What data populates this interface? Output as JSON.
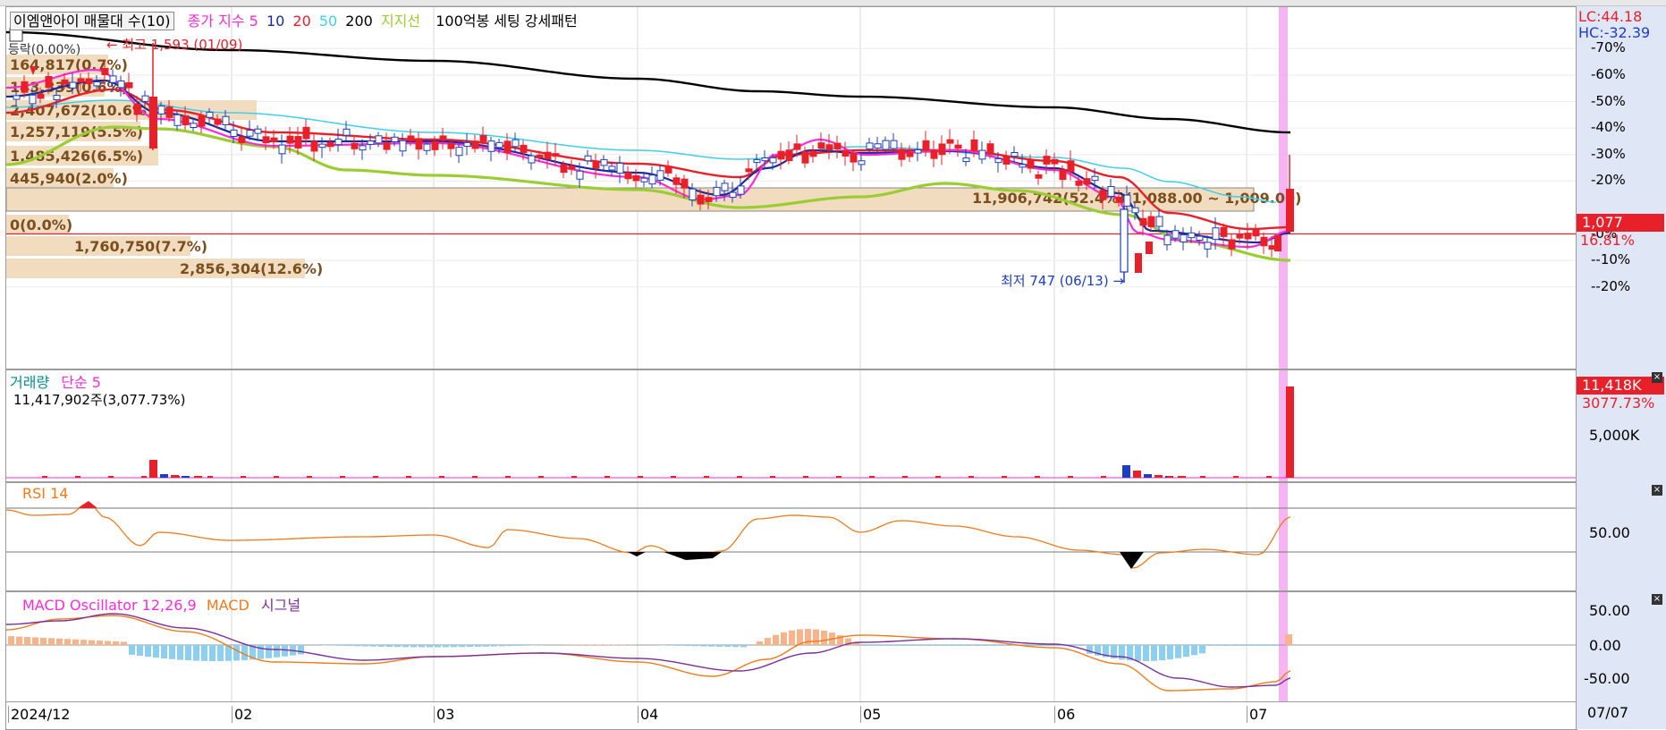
{
  "colors": {
    "up": "#e8202a",
    "down": "#1d3fbf",
    "ma5": "#ff2bd6",
    "ma10": "#1b2a9a",
    "ma20": "#e8202a",
    "ma50": "#3fd0e8",
    "ma200": "#000000",
    "support": "#9acd32",
    "profile": "#f2dcc0",
    "profile_text": "#7a4e1d",
    "axis_bg": "#dfe6f5",
    "highlight": "#f4a7f0",
    "rsi": "#f07a1a",
    "macd": "#f07a1a",
    "signal": "#7b2f9a",
    "osc_pos": "#f7b48a",
    "osc_neg": "#8ccfee"
  },
  "price_panel": {
    "legend": {
      "title": "이엠앤아이 매물대 수(10)",
      "close_ma_label": "종가 지수",
      "ma_periods": [
        "5",
        "10",
        "20",
        "50",
        "200"
      ],
      "support_label": "지지선",
      "pattern_label": "100억봉 세팅 강세패턴"
    },
    "axis_right": {
      "lc": "LC:44.18",
      "hc": "HC:-32.39",
      "pct_ticks": [
        "70%",
        "60%",
        "50%",
        "40%",
        "30%",
        "20%",
        "0%",
        "-10%",
        "-20%"
      ],
      "current_price": "1,077",
      "current_pct": "16.81%"
    },
    "annotations": {
      "high": "최고 1,593 (01/09)",
      "low": "최저 747 (06/13)",
      "truncated_left": "등락(0.00%)"
    },
    "volume_profile": [
      {
        "label": "164,817(0.7%)",
        "vol": 164817
      },
      {
        "label": "143,339(0.6%)",
        "vol": 143339
      },
      {
        "label": "2,407,672(10.6%)",
        "vol": 2407672
      },
      {
        "label": "1,257,119(5.5%)",
        "vol": 1257119
      },
      {
        "label": "1,485,426(6.5%)",
        "vol": 1485426
      },
      {
        "label": "445,940(2.0%)",
        "vol": 445940
      },
      {
        "label": "11,906,742(52.4%)(1,088.00 ~ 1,009.00)",
        "vol": 11906742
      },
      {
        "label": "0(0.0%)",
        "vol": 0
      },
      {
        "label": "1,760,750(7.7%)",
        "vol": 1760750
      },
      {
        "label": "2,856,304(12.6%)",
        "vol": 2856304
      }
    ]
  },
  "volume_panel": {
    "legend_title": "거래량",
    "legend_ma": "단순 5",
    "value_text": "11,417,902주(3,077.73%)",
    "axis_value": "11,418K",
    "axis_pct": "3077.73%",
    "axis_tick": "5,000K"
  },
  "rsi_panel": {
    "legend": "RSI 14",
    "axis_tick": "50.00"
  },
  "macd_panel": {
    "legend_osc": "MACD Oscillator 12,26,9",
    "legend_macd": "MACD",
    "legend_signal": "시그널",
    "axis_ticks": [
      "50.00",
      "0.00",
      "-50.00"
    ]
  },
  "x_axis": {
    "labels": [
      "2024/12",
      "02",
      "03",
      "04",
      "05",
      "06",
      "07"
    ],
    "right_label": "07/07"
  },
  "chart_data": {
    "type": "candlestick",
    "title": "이엠앤아이",
    "x": [
      "2024/12",
      "02",
      "03",
      "04",
      "05",
      "06",
      "07"
    ],
    "pct_range": [
      -20,
      70
    ],
    "series": [
      {
        "name": "종가 지수",
        "type": "candlestick",
        "values": [
          {
            "x": "01/09",
            "high": 1593
          },
          {
            "x": "06/13",
            "low": 747
          },
          {
            "x": "07/07",
            "close": 1077,
            "change_pct": 16.81
          }
        ]
      },
      {
        "name": "거래량",
        "type": "bar",
        "values": [
          {
            "x": "07/07",
            "value": 11417902,
            "pct": 3077.73
          }
        ]
      }
    ]
  }
}
